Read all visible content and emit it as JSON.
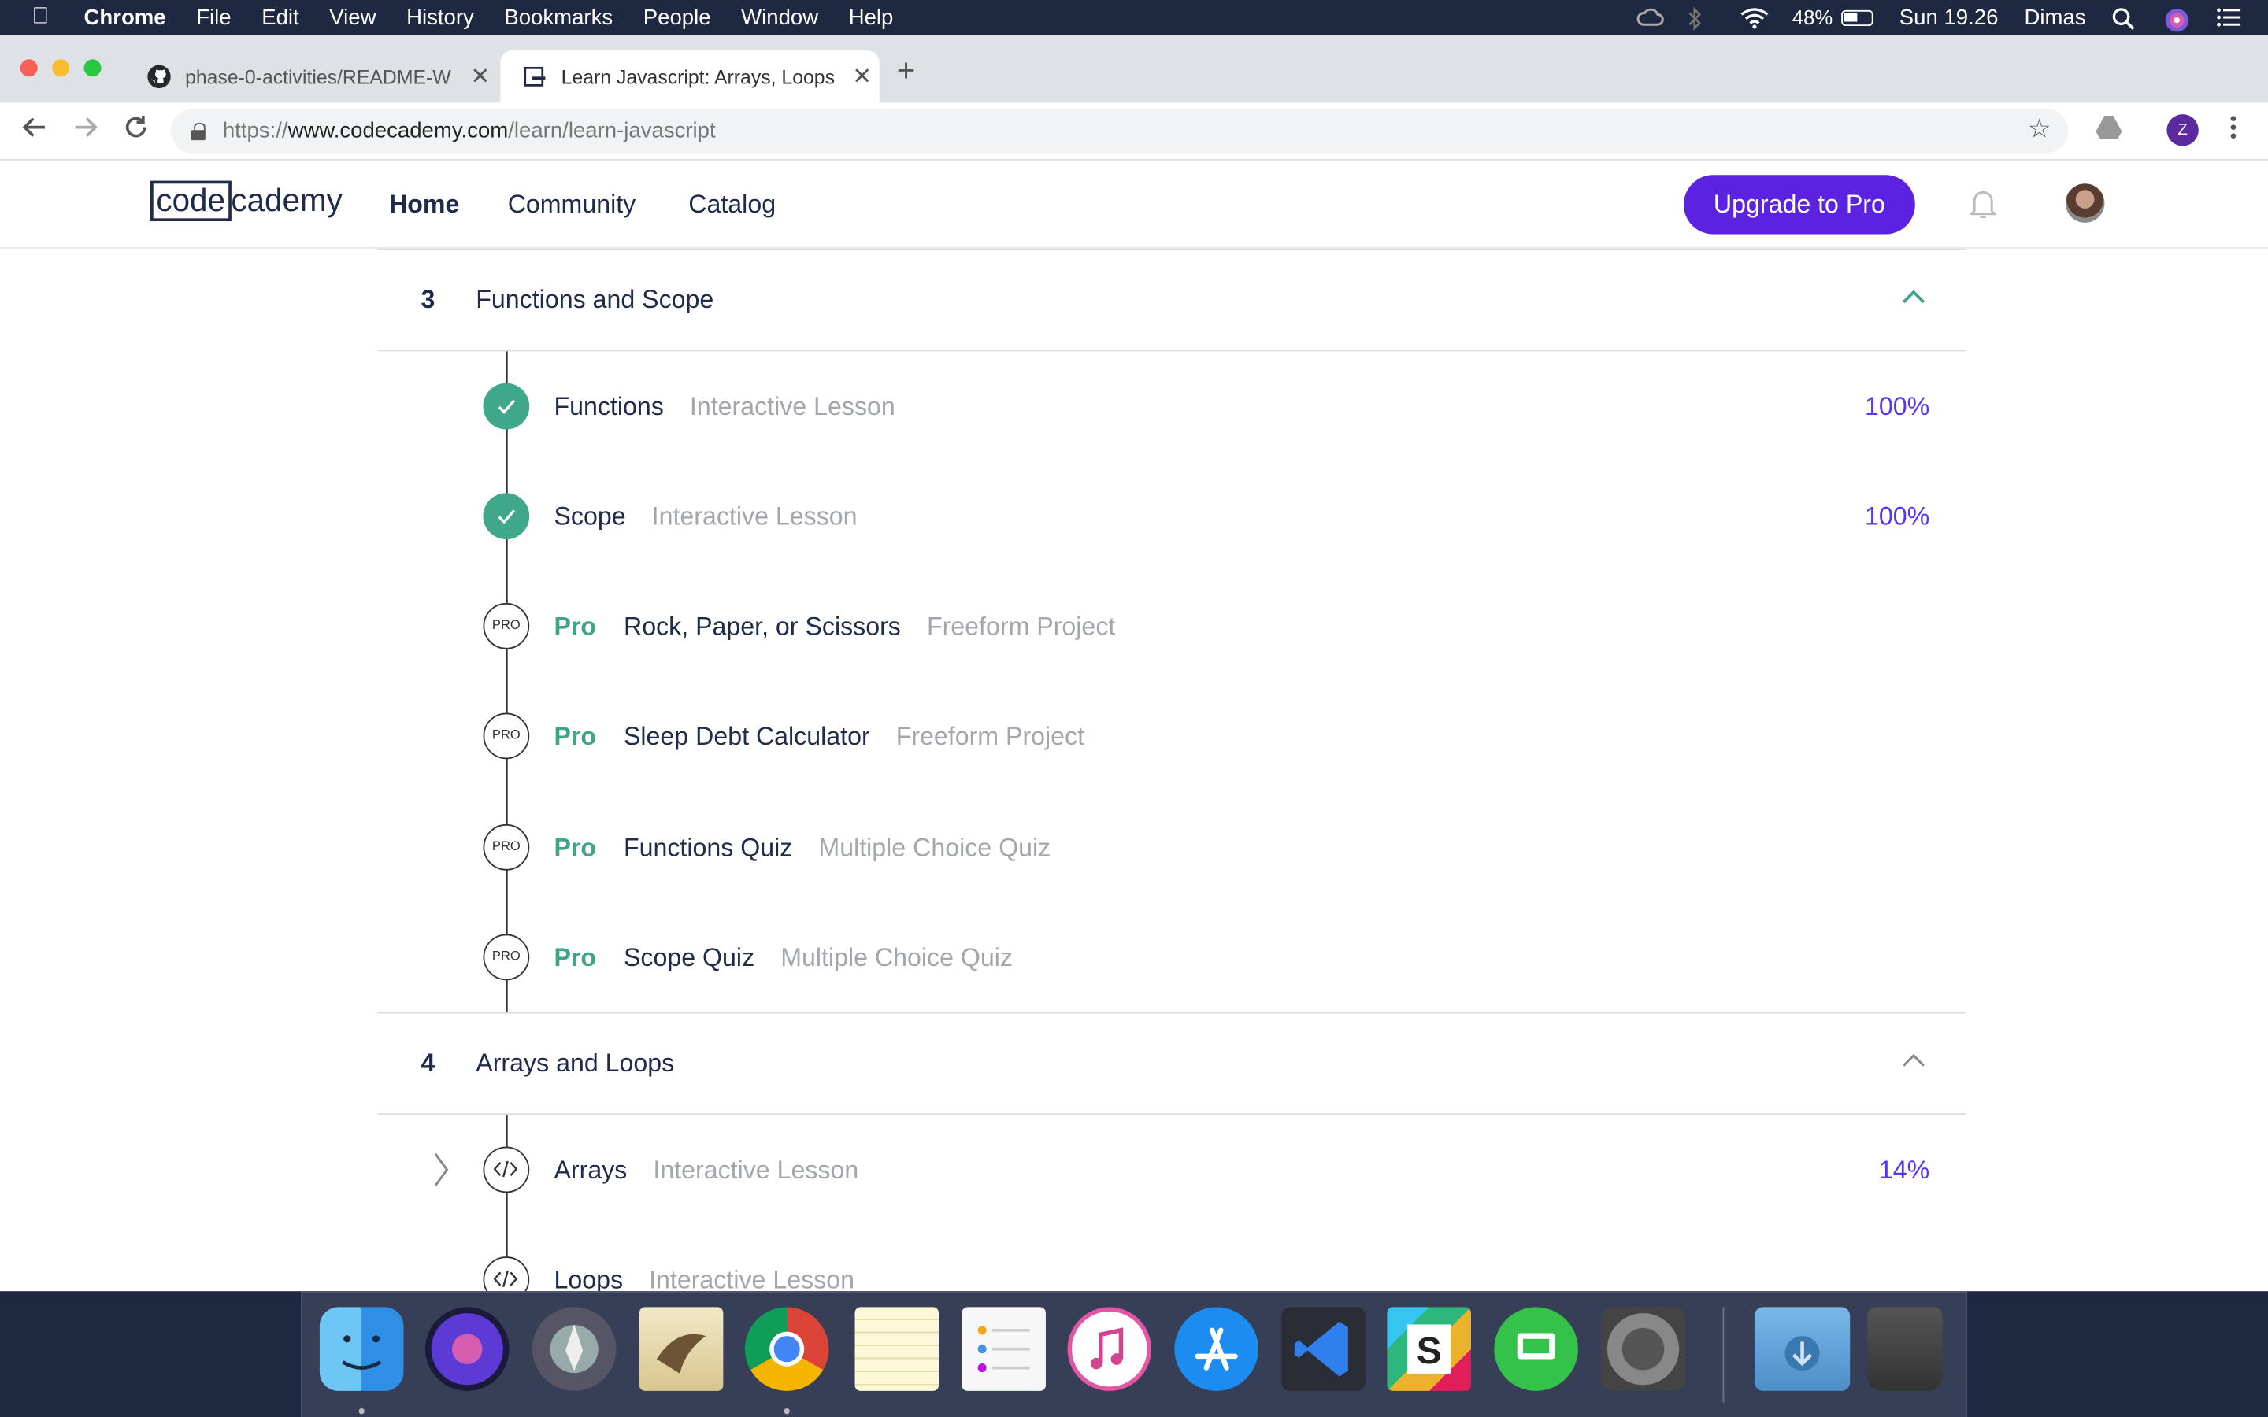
{
  "menubar": {
    "apple_icon": "apple-icon",
    "items": [
      "Chrome",
      "File",
      "Edit",
      "View",
      "History",
      "Bookmarks",
      "People",
      "Window",
      "Help"
    ],
    "battery_percent": "48%",
    "clock": "Sun 19.26",
    "user": "Dimas"
  },
  "tabs": [
    {
      "title": "phase-0-activities/README-W",
      "favicon": "github-icon",
      "active": false
    },
    {
      "title": "Learn Javascript: Arrays, Loops",
      "favicon": "codecademy-icon",
      "active": true
    }
  ],
  "toolbar": {
    "url_prefix": "https://",
    "url_host": "www.codecademy.com",
    "url_path": "/learn/learn-javascript",
    "profile_initial": "Z"
  },
  "header": {
    "logo_boxed": "code",
    "logo_rest": "cademy",
    "nav": [
      "Home",
      "Community",
      "Catalog"
    ],
    "upgrade_label": "Upgrade to Pro"
  },
  "sections": [
    {
      "number": "3",
      "title": "Functions and Scope",
      "items": [
        {
          "status": "done",
          "pro": false,
          "name": "Functions",
          "type": "Interactive Lesson",
          "progress": "100%"
        },
        {
          "status": "done",
          "pro": false,
          "name": "Scope",
          "type": "Interactive Lesson",
          "progress": "100%"
        },
        {
          "status": "pro",
          "pro": true,
          "pro_label": "Pro",
          "badge_label": "PRO",
          "name": "Rock, Paper, or Scissors",
          "type": "Freeform Project",
          "progress": ""
        },
        {
          "status": "pro",
          "pro": true,
          "pro_label": "Pro",
          "badge_label": "PRO",
          "name": "Sleep Debt Calculator",
          "type": "Freeform Project",
          "progress": ""
        },
        {
          "status": "pro",
          "pro": true,
          "pro_label": "Pro",
          "badge_label": "PRO",
          "name": "Functions Quiz",
          "type": "Multiple Choice Quiz",
          "progress": ""
        },
        {
          "status": "pro",
          "pro": true,
          "pro_label": "Pro",
          "badge_label": "PRO",
          "name": "Scope Quiz",
          "type": "Multiple Choice Quiz",
          "progress": ""
        }
      ]
    },
    {
      "number": "4",
      "title": "Arrays and Loops",
      "items": [
        {
          "status": "code",
          "pro": false,
          "name": "Arrays",
          "type": "Interactive Lesson",
          "progress": "14%"
        },
        {
          "status": "code",
          "pro": false,
          "name": "Loops",
          "type": "Interactive Lesson",
          "progress": ""
        }
      ]
    }
  ],
  "colors": {
    "navy": "#1f2b49",
    "green": "#3fa587",
    "purple": "#5b22e0",
    "progress_blue": "#5533ff",
    "muted": "#a4a6ad"
  },
  "dock": [
    "finder-icon",
    "siri-icon",
    "launchpad-icon",
    "mail-icon",
    "chrome-icon",
    "notes-icon",
    "reminders-icon",
    "itunes-icon",
    "app-store-icon",
    "vscode-icon",
    "slides-icon",
    "screen-sharing-icon",
    "system-preferences-icon",
    "downloads-icon",
    "trash-icon"
  ]
}
